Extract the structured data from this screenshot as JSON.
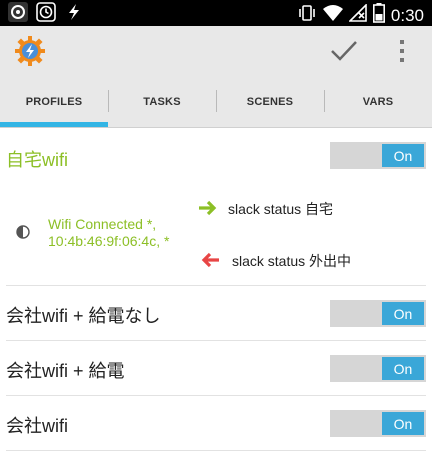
{
  "status_bar": {
    "time": "0:30",
    "left_icons": [
      "tasker-notification-icon",
      "clock-icon",
      "lightning-icon"
    ],
    "right_icons": [
      "vibrate-icon",
      "wifi-icon",
      "signal-off-icon",
      "battery-icon"
    ]
  },
  "action_bar": {
    "icons": [
      "tasker-app-icon",
      "checkmark-icon",
      "overflow-menu-icon"
    ]
  },
  "tabs": [
    {
      "label": "PROFILES",
      "active": true
    },
    {
      "label": "TASKS",
      "active": false
    },
    {
      "label": "SCENES",
      "active": false
    },
    {
      "label": "VARS",
      "active": false
    }
  ],
  "colors": {
    "accent_blue": "#33b5e5",
    "toggle_on": "#3aa7d8",
    "active_profile_green": "#8cbf26",
    "enter_arrow_green": "#8cbf26",
    "exit_arrow_red": "#e84545"
  },
  "profiles": [
    {
      "name": "自宅wifi",
      "toggle": "On",
      "expanded": true,
      "context_line1": "Wifi Connected *,",
      "context_line2": "10:4b:46:9f:06:4c, *",
      "enter_task": "slack status 自宅",
      "exit_task": "slack status 外出中"
    },
    {
      "name": "会社wifi + 給電なし",
      "toggle": "On"
    },
    {
      "name": "会社wifi + 給電",
      "toggle": "On"
    },
    {
      "name": "会社wifi",
      "toggle": "On"
    }
  ]
}
